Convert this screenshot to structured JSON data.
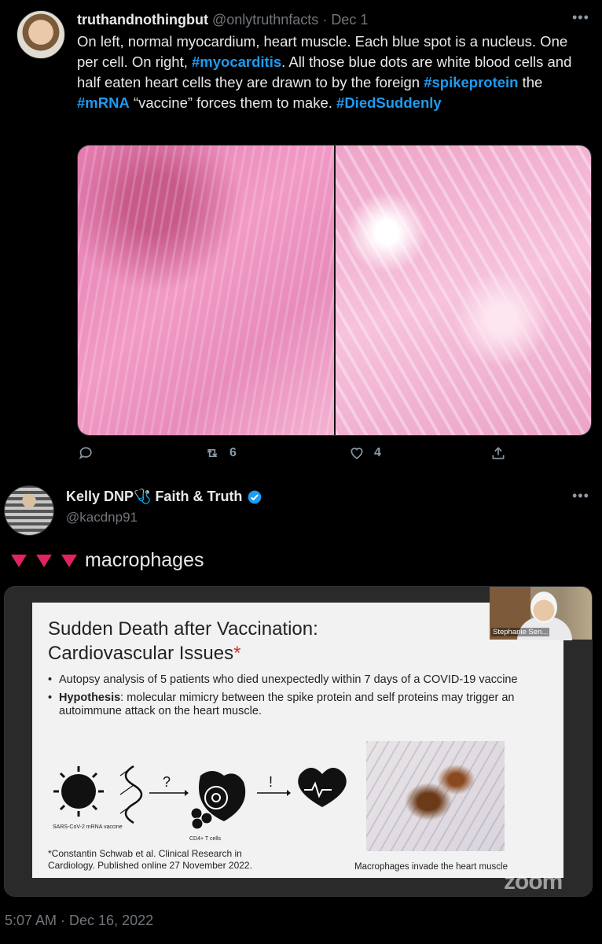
{
  "tweet1": {
    "name": "truthandnothingbut",
    "handle": "@onlytruthnfacts",
    "separator": " · ",
    "date": "Dec 1",
    "text_parts": [
      "On left, normal myocardium, heart muscle. Each blue spot is a nucleus. One per cell. On right, ",
      "#myocarditis",
      ". All those blue dots are white blood cells and half eaten heart cells they are drawn to by the foreign ",
      "#spikeprotein",
      " the ",
      "#mRNA",
      " “vaccine” forces them to make. ",
      "#DiedSuddenly"
    ],
    "retweets": "6",
    "likes": "4"
  },
  "tweet2": {
    "name": "Kelly DNP🩺 Faith & Truth",
    "handle": "@kacdnp91",
    "text": "macrophages",
    "timestamp": "5:07 AM · Dec 16, 2022"
  },
  "slide": {
    "title_line1": "Sudden Death after Vaccination:",
    "title_line2": "Cardiovascular Issues",
    "title_mark": "*",
    "bullet1": "Autopsy analysis of 5 patients who died unexpectedly within 7 days of a COVID-19 vaccine",
    "bullet2_bold": "Hypothesis",
    "bullet2_rest": ": molecular mimicry between the spike protein and self proteins may trigger an autoimmune attack on the heart muscle.",
    "diagram_q": "?",
    "diagram_excl": "!",
    "virus_label": "SARS-CoV-2 mRNA vaccine",
    "tcell_label": "CD4+ T cells",
    "citation_line1": "*Constantin Schwab et al. Clinical Research in",
    "citation_line2": "Cardiology. Published online 27 November 2022.",
    "image_caption": "Macrophages invade the heart muscle",
    "watermark": "zoom",
    "video_name": "Stephanie Sen..."
  },
  "icons": {
    "reply": "reply-icon",
    "retweet": "retweet-icon",
    "like": "heart-icon",
    "share": "share-icon",
    "more": "more-icon",
    "verified": "verified-badge-icon",
    "triangle": "red-triangle-icon"
  },
  "colors": {
    "background": "#000000",
    "hashtag": "#1d9bf0",
    "muted": "#71767b",
    "triangle": "#e0245e"
  }
}
